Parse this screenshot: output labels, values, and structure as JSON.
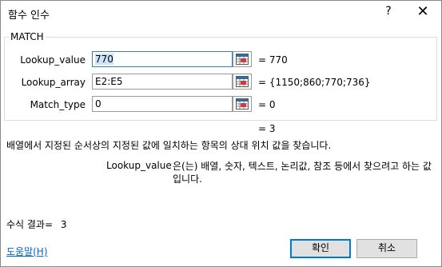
{
  "window": {
    "title": "함수 인수",
    "help_label": "?",
    "close_label": "✕"
  },
  "function_group": {
    "name": "MATCH",
    "arguments": [
      {
        "label": "Lookup_value",
        "value": "770",
        "result": "=  770"
      },
      {
        "label": "Lookup_array",
        "value": "E2:E5",
        "result": "=  {1150;860;770;736}"
      },
      {
        "label": "Match_type",
        "value": "0",
        "result": "=  0"
      }
    ]
  },
  "formula_result_inline": "=  3",
  "description": "배열에서 지정된 순서상의 지정된 값에 일치하는 항목의 상대 위치 값을 찾습니다.",
  "argument_help": {
    "name": "Lookup_value",
    "text": "은(는) 배열, 숫자, 텍스트, 논리값, 참조 등에서 찾으려고 하는 값입니다."
  },
  "result": {
    "label": "수식 결과=",
    "value": "3"
  },
  "help_link": "도움말(H)",
  "buttons": {
    "ok": "확인",
    "cancel": "취소"
  },
  "icons": {
    "ref": "range-select-icon"
  }
}
